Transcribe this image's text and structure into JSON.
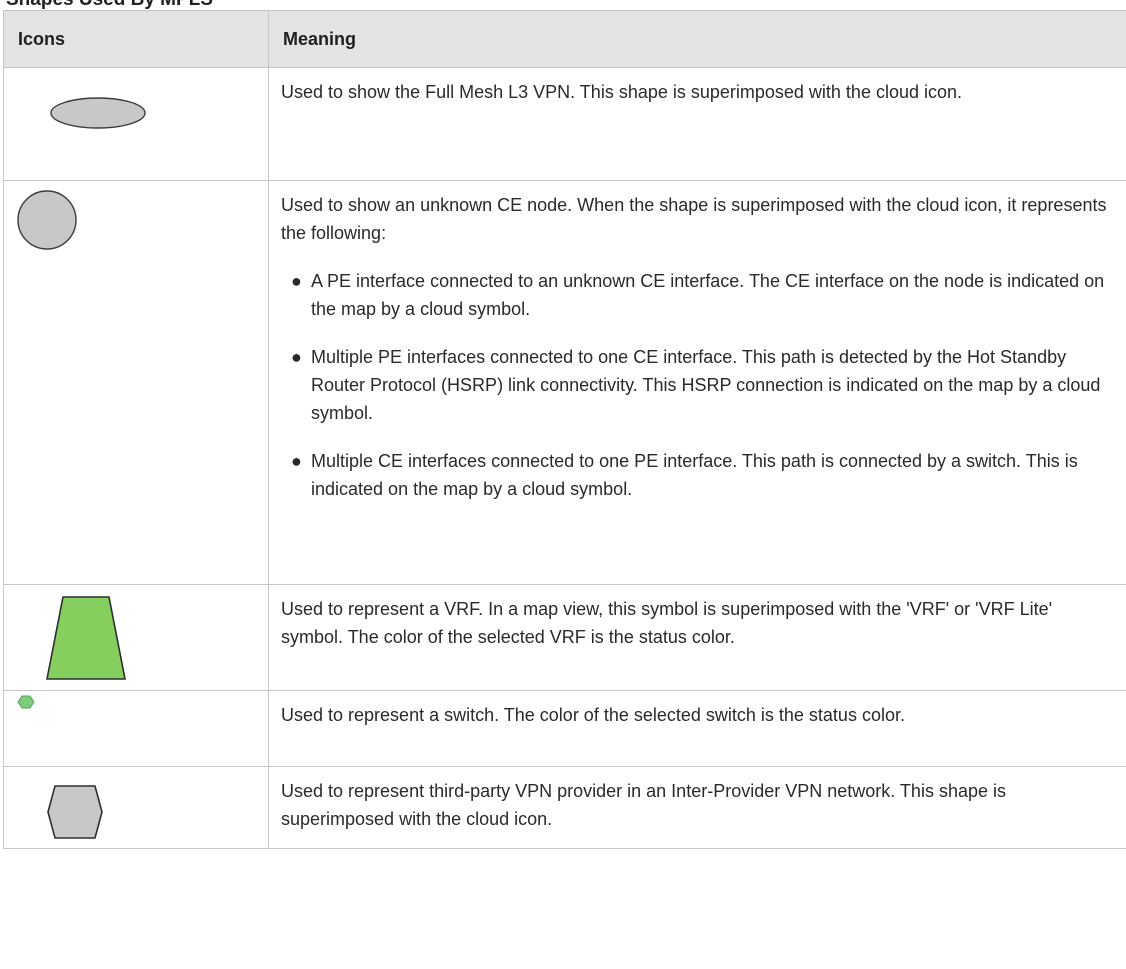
{
  "caption": "Shapes Used By MPLS",
  "headers": {
    "icons": "Icons",
    "meaning": "Meaning"
  },
  "colors": {
    "shape_gray": "#c8c8c8",
    "vrf_green": "#86cf5f",
    "switch_green": "#7dcb7d",
    "border": "#c6c6c6",
    "header_bg": "#e3e3e3"
  },
  "rows": [
    {
      "icon": "ellipse-icon",
      "meaning": "Used to show the Full Mesh L3 VPN. This shape is superimposed with the cloud icon."
    },
    {
      "icon": "circle-icon",
      "meaning": "Used to show an unknown CE node. When the shape is superimposed with the cloud icon, it represents the following:",
      "bullets": [
        "A PE interface connected to an unknown CE interface. The CE interface on the node is indicated on the map by a cloud symbol.",
        "Multiple PE interfaces connected to one CE interface. This path is detected by the Hot Standby Router Protocol (HSRP) link connectivity. This HSRP connection is indicated on the map by a cloud symbol.",
        "Multiple CE interfaces connected to one PE interface. This path is connected by a switch. This is indicated on the map by a cloud symbol."
      ]
    },
    {
      "icon": "trapezoid-icon",
      "meaning": "Used to represent a VRF. In a map view, this symbol is superimposed with the 'VRF' or 'VRF Lite' symbol. The color of the selected VRF is the status color."
    },
    {
      "icon": "hexagon-icon",
      "meaning": "Used to represent a switch. The color of the selected switch is the status color."
    },
    {
      "icon": "octagon-icon",
      "meaning": "Used to represent third-party VPN provider in an Inter-Provider VPN network. This shape is superimposed with the cloud icon."
    }
  ]
}
